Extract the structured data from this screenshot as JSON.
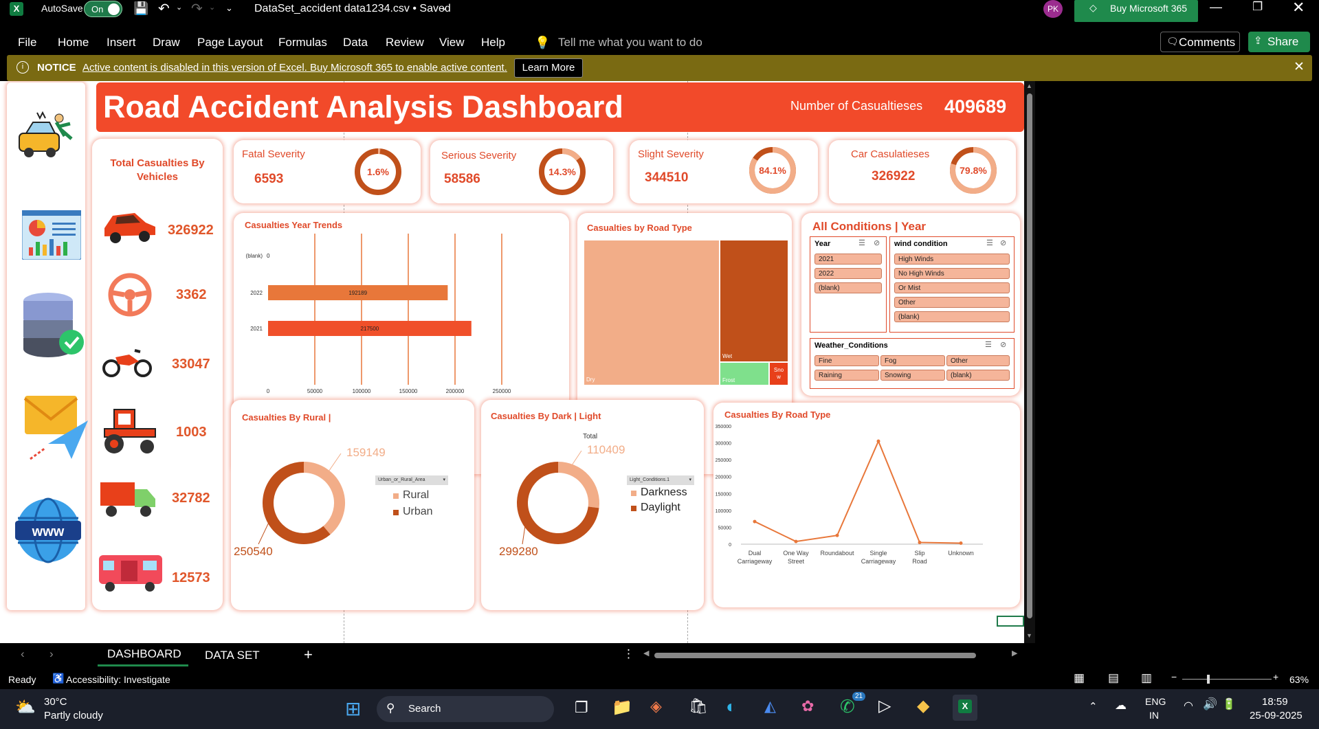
{
  "titlebar": {
    "autosave_label": "AutoSave",
    "autosave_state": "On",
    "filename": "DataSet_accident data1234.csv • Saved",
    "user_initials": "PK",
    "buy_label": "Buy Microsoft 365"
  },
  "ribbon": {
    "tabs": [
      "File",
      "Home",
      "Insert",
      "Draw",
      "Page Layout",
      "Formulas",
      "Data",
      "Review",
      "View",
      "Help"
    ],
    "tell_me": "Tell me what you want to do",
    "comments": "Comments",
    "share": "Share"
  },
  "notice": {
    "label": "NOTICE",
    "text": "Active content is disabled in this version of Excel. Buy Microsoft 365 to enable active content.",
    "button": "Learn More"
  },
  "dashboard": {
    "title": "Road Accident Analysis Dashboard",
    "casualties_label": "Number of Casualtieses",
    "casualties_value": "409689",
    "kpis": [
      {
        "label": "Fatal Severity",
        "value": "6593",
        "pct": "1.6%",
        "fraction": 0.016
      },
      {
        "label": "Serious Severity",
        "value": "58586",
        "pct": "14.3%",
        "fraction": 0.143
      },
      {
        "label": "Slight Severity",
        "value": "344510",
        "pct": "84.1%",
        "fraction": 0.841
      },
      {
        "label": "Car Casulatieses",
        "value": "326922",
        "pct": "79.8%",
        "fraction": 0.798
      }
    ],
    "vehicles_title": "Total Casualties By Vehicles",
    "vehicles": [
      {
        "icon": "car-icon",
        "value": "326922"
      },
      {
        "icon": "steering-wheel-icon",
        "value": "3362"
      },
      {
        "icon": "motorcycle-icon",
        "value": "33047"
      },
      {
        "icon": "tractor-icon",
        "value": "1003"
      },
      {
        "icon": "truck-icon",
        "value": "32782"
      },
      {
        "icon": "bus-icon",
        "value": "12573"
      }
    ],
    "year_trend_title": "Casualties Year Trends",
    "road_type_title": "Casualties by Road Type",
    "conditions_title": "All Conditions | Year",
    "slicers": {
      "year": {
        "title": "Year",
        "items": [
          "2021",
          "2022",
          "(blank)"
        ]
      },
      "wind": {
        "title": "wind condition",
        "items": [
          "High Winds",
          "No High Winds",
          "Or Mist",
          "Other",
          "(blank)"
        ]
      },
      "weather": {
        "title": "Weather_Conditions",
        "items": [
          "Fine",
          "Fog",
          "Other",
          "Raining",
          "Snowing",
          "(blank)"
        ]
      }
    },
    "rural_title": "Casualties By Rural |",
    "rural_filter": "Urban_or_Rural_Area",
    "dark_title": "Casualties By Dark | Light",
    "dark_total": "Total",
    "dark_filter": "Light_Conditions.1",
    "road_line_title": "Casualties By Road Type"
  },
  "chart_data": [
    {
      "type": "bar",
      "orientation": "horizontal",
      "categories": [
        "(blank)",
        "2022",
        "2021"
      ],
      "values": [
        0,
        192189,
        217500
      ],
      "xlim": [
        0,
        250000
      ],
      "xticks": [
        "0",
        "50000",
        "100000",
        "150000",
        "200000",
        "250000"
      ],
      "colors": [
        "#e8773a",
        "#e8773a",
        "#f0502a"
      ]
    },
    {
      "type": "treemap",
      "categories": [
        "Dry",
        "Wet",
        "Frost",
        "Snow"
      ],
      "labels": [
        "Dry",
        "Wet",
        "Frost",
        "Sno w"
      ],
      "colors": [
        "#f2ad88",
        "#c0501a",
        "#7fe08c",
        "#e8401a"
      ]
    },
    {
      "type": "pie",
      "series_field": "Urban_or_Rural_Area",
      "categories": [
        "Rural",
        "Urban"
      ],
      "values": [
        159149,
        250540
      ],
      "colors": [
        "#f2ad88",
        "#c0501a"
      ]
    },
    {
      "type": "pie",
      "series_field": "Light_Conditions.1",
      "categories": [
        "Darkness",
        "Daylight"
      ],
      "values": [
        110409,
        299280
      ],
      "colors": [
        "#f2ad88",
        "#c0501a"
      ]
    },
    {
      "type": "line",
      "categories": [
        "Dual Carriageway",
        "One Way Street",
        "Roundabout",
        "Single Carriageway",
        "Slip Road",
        "Unknown"
      ],
      "values": [
        67000,
        8000,
        26000,
        305000,
        5000,
        3000
      ],
      "ylim": [
        0,
        350000
      ],
      "yticks": [
        "0",
        "50000",
        "100000",
        "150000",
        "200000",
        "250000",
        "300000",
        "350000"
      ],
      "color": "#e8773a"
    }
  ],
  "sheettabs": {
    "tabs": [
      "DASHBOARD",
      "DATA SET"
    ],
    "add": "+"
  },
  "statusbar": {
    "ready": "Ready",
    "accessibility": "Accessibility: Investigate",
    "zoom": "63%"
  },
  "taskbar": {
    "temp": "30°C",
    "weather": "Partly cloudy",
    "search": "Search",
    "lang1": "ENG",
    "lang2": "IN",
    "time": "18:59",
    "date": "25-09-2025",
    "whatsapp_badge": "21"
  }
}
